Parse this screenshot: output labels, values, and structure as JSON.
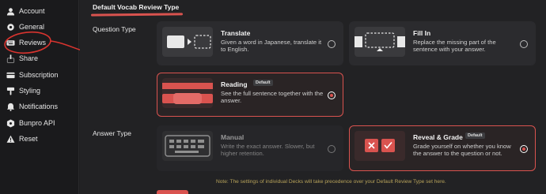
{
  "sidebar": {
    "items": [
      {
        "label": "Account",
        "icon": "user-icon"
      },
      {
        "label": "General",
        "icon": "gear-icon"
      },
      {
        "label": "Reviews",
        "icon": "keyboard-icon"
      },
      {
        "label": "Share",
        "icon": "share-icon"
      },
      {
        "label": "Subscription",
        "icon": "card-icon"
      },
      {
        "label": "Styling",
        "icon": "paint-icon"
      },
      {
        "label": "Notifications",
        "icon": "bell-icon"
      },
      {
        "label": "Bunpro API",
        "icon": "code-icon"
      },
      {
        "label": "Reset",
        "icon": "warning-icon"
      }
    ]
  },
  "main": {
    "section_title": "Default Vocab Review Type",
    "question_type_label": "Question Type",
    "answer_type_label": "Answer Type",
    "question_options": [
      {
        "title": "Translate",
        "desc": "Given a word in Japanese, translate it to English.",
        "selected": false
      },
      {
        "title": "Fill In",
        "desc": "Replace the missing part of the sentence with your answer.",
        "selected": false
      },
      {
        "title": "Reading",
        "badge": "Default",
        "desc": "See the full sentence together with the answer.",
        "selected": true
      }
    ],
    "answer_options": [
      {
        "title": "Manual",
        "desc": "Write the exact answer. Slower, but higher retention.",
        "selected": false
      },
      {
        "title": "Reveal & Grade",
        "badge": "Default",
        "desc": "Grade yourself on whether you know the answer to the question or not.",
        "selected": true
      }
    ],
    "note": "Note: The settings of individual Decks will take precedence over your Default Review Type set here."
  },
  "colors": {
    "accent": "#d9534f",
    "background": "#222224",
    "sidebar": "#1a1a1c",
    "card": "#2b2b2e",
    "note": "#b8a35a"
  }
}
